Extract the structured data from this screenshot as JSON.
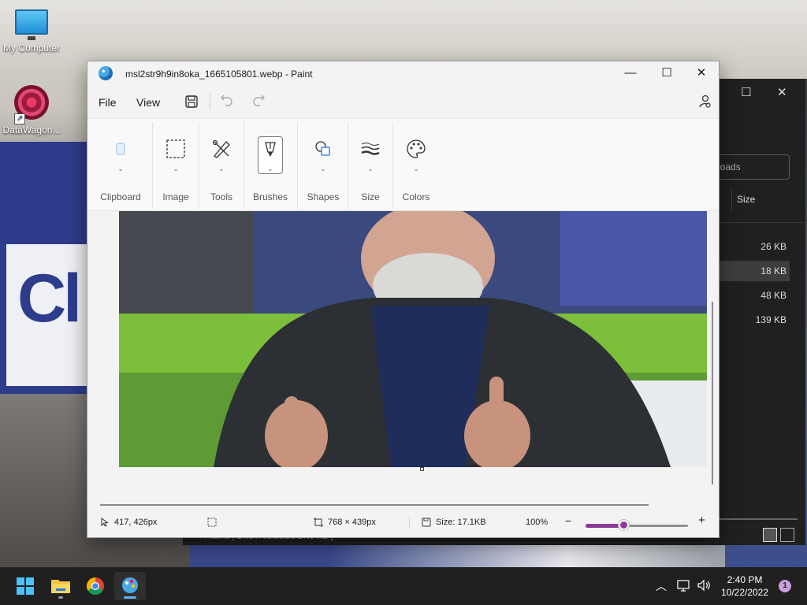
{
  "desktop": {
    "icons": [
      {
        "label": "My Computer"
      },
      {
        "label": "DataWagon..."
      }
    ]
  },
  "explorer": {
    "search_placeholder": "loads",
    "column_size": "Size",
    "rows": [
      "26 KB",
      "18 KB",
      "48 KB",
      "139 KB"
    ],
    "status_text": "4 items  |  1 item selected  17.0 KB  |"
  },
  "paint": {
    "title": "msl2str9h9in8oka_1665105801.webp - Paint",
    "menu": {
      "file": "File",
      "view": "View"
    },
    "ribbon": {
      "groups": [
        "Clipboard",
        "Image",
        "Tools",
        "Brushes",
        "Shapes",
        "Size",
        "Colors"
      ]
    },
    "status": {
      "cursor_pos": "417, 426px",
      "canvas_size": "768 × 439px",
      "file_size": "Size: 17.1KB",
      "zoom": "100%",
      "zoom_level": 0.38
    }
  },
  "taskbar": {
    "time": "2:40 PM",
    "date": "10/22/2022",
    "notifications": "1"
  },
  "colors": {
    "accent": "#8b3a96",
    "taskbar": "#202020"
  }
}
